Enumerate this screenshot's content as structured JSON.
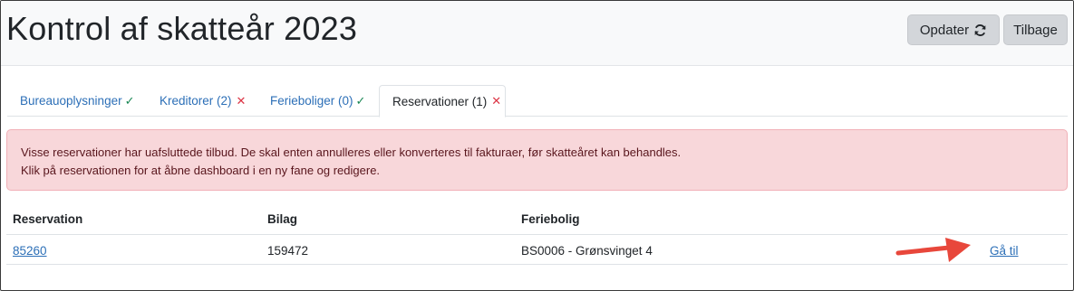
{
  "header": {
    "title": "Kontrol af skatteår 2023",
    "refresh_label": "Opdater",
    "back_label": "Tilbage"
  },
  "tabs": [
    {
      "label": "Bureauoplysninger",
      "status": "ok",
      "mark": "✓"
    },
    {
      "label": "Kreditorer (2)",
      "status": "error",
      "mark": "✕"
    },
    {
      "label": "Ferieboliger (0)",
      "status": "ok",
      "mark": "✓"
    },
    {
      "label": "Reservationer (1)",
      "status": "error",
      "mark": "✕",
      "active": true
    }
  ],
  "alert": {
    "line1": "Visse reservationer har uafsluttede tilbud. De skal enten annulleres eller konverteres til fakturaer, før skatteåret kan behandles.",
    "line2": "Klik på reservationen for at åbne dashboard i en ny fane og redigere."
  },
  "table": {
    "headers": [
      "Reservation",
      "Bilag",
      "Feriebolig"
    ],
    "rows": [
      {
        "reservation": "85260",
        "bilag": "159472",
        "feriebolig": "BS0006 - Grønsvinget 4",
        "action": "Gå til"
      }
    ]
  },
  "colors": {
    "link": "#2c6fb7",
    "ok": "#198754",
    "error": "#dc3545",
    "alert_bg": "#f8d7da",
    "annotation_arrow": "#e8473b"
  },
  "icons": {
    "refresh": "refresh-icon",
    "annotation": "red-arrow-icon"
  }
}
